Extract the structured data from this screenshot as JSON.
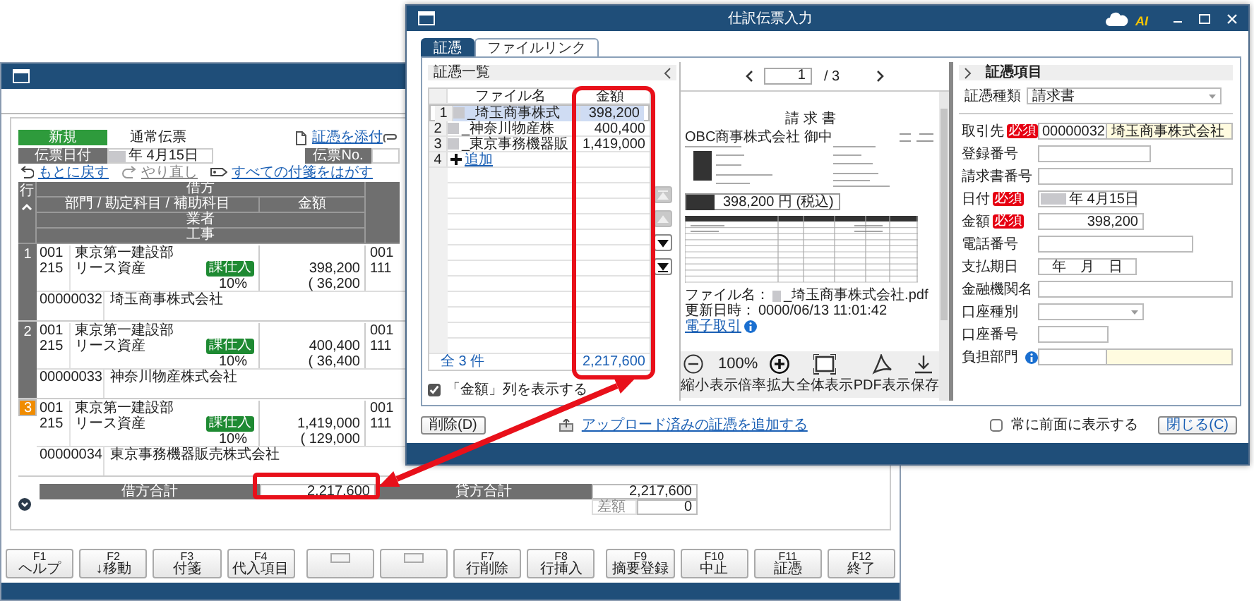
{
  "main_window": {
    "header": {
      "mode": "新規",
      "voucher_type": "通常伝票",
      "date_label": "伝票日付",
      "date_value": "年 4月15日",
      "attach_link": "証憑を添付",
      "voucher_no_label": "伝票No."
    },
    "toolbar": [
      {
        "kind": "undo",
        "label": "もとに戻す",
        "disabled": false
      },
      {
        "kind": "redo",
        "label": "やり直し",
        "disabled": true
      },
      {
        "kind": "tag",
        "label": "すべての付箋をはがす",
        "disabled": false
      }
    ],
    "table": {
      "row_header": "行",
      "headers": [
        "借方",
        "部門 / 勘定科目 / 補助科目",
        "金額",
        "業者",
        "工事"
      ],
      "rows": [
        {
          "number": "1",
          "selected": false,
          "dept_code": "001",
          "dept": "東京第一建設部",
          "account_code": "215",
          "account": "リース資産",
          "tax_badge": "課仕入",
          "tax_rate": "10%",
          "amount": "398,200",
          "tax": "( 36,200",
          "credit_dept_code": "001",
          "credit_account_code": "111",
          "vendor_code": "00000032",
          "vendor": "埼玉商事株式会社"
        },
        {
          "number": "2",
          "selected": false,
          "dept_code": "001",
          "dept": "東京第一建設部",
          "account_code": "215",
          "account": "リース資産",
          "tax_badge": "課仕入",
          "tax_rate": "10%",
          "amount": "400,400",
          "tax": "( 36,400",
          "credit_dept_code": "001",
          "credit_account_code": "111",
          "vendor_code": "00000033",
          "vendor": "神奈川物産株式会社"
        },
        {
          "number": "3",
          "selected": true,
          "dept_code": "001",
          "dept": "東京第一建設部",
          "account_code": "215",
          "account": "リース資産",
          "tax_badge": "課仕入",
          "tax_rate": "10%",
          "amount": "1,419,000",
          "tax": "( 129,000",
          "credit_dept_code": "001",
          "credit_account_code": "111",
          "vendor_code": "00000034",
          "vendor": "東京事務機器販売株式会社"
        }
      ]
    },
    "totals": {
      "debit_label": "借方合計",
      "debit_value": "2,217,600",
      "credit_label": "貸方合計",
      "credit_value": "2,217,600",
      "diff_label": "差額",
      "diff_value": "0"
    },
    "function_keys": [
      {
        "kind": "key",
        "key": "F1",
        "label": "ヘルプ"
      },
      {
        "kind": "key",
        "key": "F2",
        "label": "↓移動"
      },
      {
        "kind": "key",
        "key": "F3",
        "label": "付箋"
      },
      {
        "kind": "key",
        "key": "F4",
        "label": "代入項目"
      },
      {
        "kind": "blank"
      },
      {
        "kind": "blank"
      },
      {
        "kind": "key",
        "key": "F7",
        "label": "行削除"
      },
      {
        "kind": "key",
        "key": "F8",
        "label": "行挿入"
      },
      {
        "kind": "key",
        "key": "F9",
        "label": "摘要登録"
      },
      {
        "kind": "key",
        "key": "F10",
        "label": "中止"
      },
      {
        "kind": "key",
        "key": "F11",
        "label": "証憑"
      },
      {
        "kind": "key",
        "key": "F12",
        "label": "終了"
      }
    ]
  },
  "dialog": {
    "title": "仕訳伝票入力",
    "ai_label": "AI",
    "tabs": [
      {
        "label": "証憑",
        "selected": true
      },
      {
        "label": "ファイルリンク",
        "selected": false
      }
    ],
    "list": {
      "title": "証憑一覧",
      "columns": [
        "ファイル名",
        "金額"
      ],
      "rows": [
        {
          "number": "1",
          "file": "_埼玉商事株式",
          "amount": "398,200",
          "selected": true
        },
        {
          "number": "2",
          "file": "_神奈川物産株",
          "amount": "400,400",
          "selected": false
        },
        {
          "number": "3",
          "file": "_東京事務機器販",
          "amount": "1,419,000",
          "selected": false
        }
      ],
      "add_row": {
        "number": "4",
        "label": "追加"
      },
      "footer_count": "全 3 件",
      "footer_total": "2,217,600",
      "show_amount": {
        "label": "「金額」列を表示する",
        "checked": true
      },
      "move_buttons": [
        {
          "kind": "top",
          "disabled": true
        },
        {
          "kind": "up",
          "disabled": true
        },
        {
          "kind": "down",
          "disabled": false
        },
        {
          "kind": "bottom",
          "disabled": false
        }
      ]
    },
    "preview": {
      "page": "1",
      "page_total": "/ 3",
      "document": {
        "title": "請 求 書",
        "addressee": "OBC商事株式会社 御中",
        "total": "398,200 円 (税込)"
      },
      "file_label": "ファイル名：",
      "file_name": "_埼玉商事株式会社.pdf",
      "updated_label": "更新日時：",
      "updated_value": "0000/06/13 11:01:42",
      "e_transaction": "電子取引",
      "zoom": "100%",
      "tools": [
        {
          "kind": "zoom-out",
          "label": "縮小"
        },
        {
          "kind": "zoom-level",
          "label": "表示倍率"
        },
        {
          "kind": "zoom-in",
          "label": "拡大"
        },
        {
          "kind": "fit",
          "label": "全体表示"
        },
        {
          "kind": "pdf",
          "label": "PDF表示"
        },
        {
          "kind": "save",
          "label": "保存"
        }
      ]
    },
    "fields_panel": {
      "title": "証憑項目",
      "type_label": "証憑種類",
      "type_value": "請求書",
      "fields": [
        {
          "label": "取引先",
          "badge": "必須",
          "help": false,
          "kind": "code-name",
          "code": "00000032",
          "value": "埼玉商事株式会社"
        },
        {
          "label": "登録番号",
          "help": false,
          "kind": "text"
        },
        {
          "label": "請求書番号",
          "help": false,
          "kind": "text"
        },
        {
          "label": "日付",
          "badge": "必須",
          "help": false,
          "kind": "date",
          "value": "年 4月15日"
        },
        {
          "label": "金額",
          "badge": "必須",
          "help": false,
          "kind": "amount",
          "value": "398,200"
        },
        {
          "label": "電話番号",
          "help": false,
          "kind": "text"
        },
        {
          "label": "支払期日",
          "help": false,
          "kind": "center",
          "value": "年　月　日"
        },
        {
          "label": "金融機関名",
          "help": false,
          "kind": "text"
        },
        {
          "label": "口座種別",
          "help": false,
          "kind": "select"
        },
        {
          "label": "口座番号",
          "help": false,
          "kind": "text"
        },
        {
          "label": "負担部門",
          "help": true,
          "kind": "code-name"
        }
      ]
    },
    "bottom": {
      "delete": "削除(D)",
      "upload_link": "アップロード済みの証憑を追加する",
      "always_on_top": {
        "label": "常に前面に表示する",
        "checked": false
      },
      "close": "閉じる(C)"
    }
  }
}
